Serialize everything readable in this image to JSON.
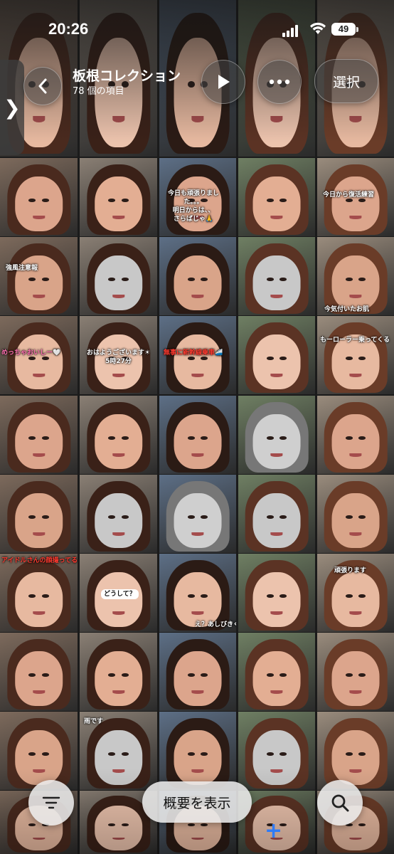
{
  "status_bar": {
    "time": "20:26",
    "battery": "49"
  },
  "header": {
    "title": "板根コレクション",
    "subtitle": "78 個の項目",
    "select_label": "選択"
  },
  "bottom_bar": {
    "summary_label": "概要を表示"
  },
  "icons": {
    "back": "chevron-left-icon",
    "play": "play-icon",
    "more": "more-icon",
    "sidebar": "sidebar-toggle-icon",
    "filter": "filter-icon",
    "search": "search-icon",
    "add": "plus-icon"
  },
  "captions": [
    {
      "id": "c1",
      "text": "今日も頑張りまし\nた。。。\n明日からは、、\nさらばじゃ🙏"
    },
    {
      "id": "c2",
      "text": "今日から復活練習"
    },
    {
      "id": "c3",
      "text": "強風注意報"
    },
    {
      "id": "c4",
      "text": "今気付いたお肌"
    },
    {
      "id": "c5",
      "text": "めっちゃおいしー🤍"
    },
    {
      "id": "c6",
      "text": "おはようございます☀\n5時27分"
    },
    {
      "id": "c7",
      "text": "無事に新幹線乗車🚄"
    },
    {
      "id": "c8",
      "text": "もーローラー乗ってくる"
    },
    {
      "id": "c9",
      "text": "アイドルさんの顔撮ってる"
    },
    {
      "id": "c10",
      "text": "どうして？"
    },
    {
      "id": "c11",
      "text": "え？あしびきくない？"
    },
    {
      "id": "c12",
      "text": "頑張ります"
    },
    {
      "id": "c13",
      "text": "雨です"
    }
  ],
  "colors": {
    "accent": "#2f7bf6",
    "glass": "#474747"
  }
}
